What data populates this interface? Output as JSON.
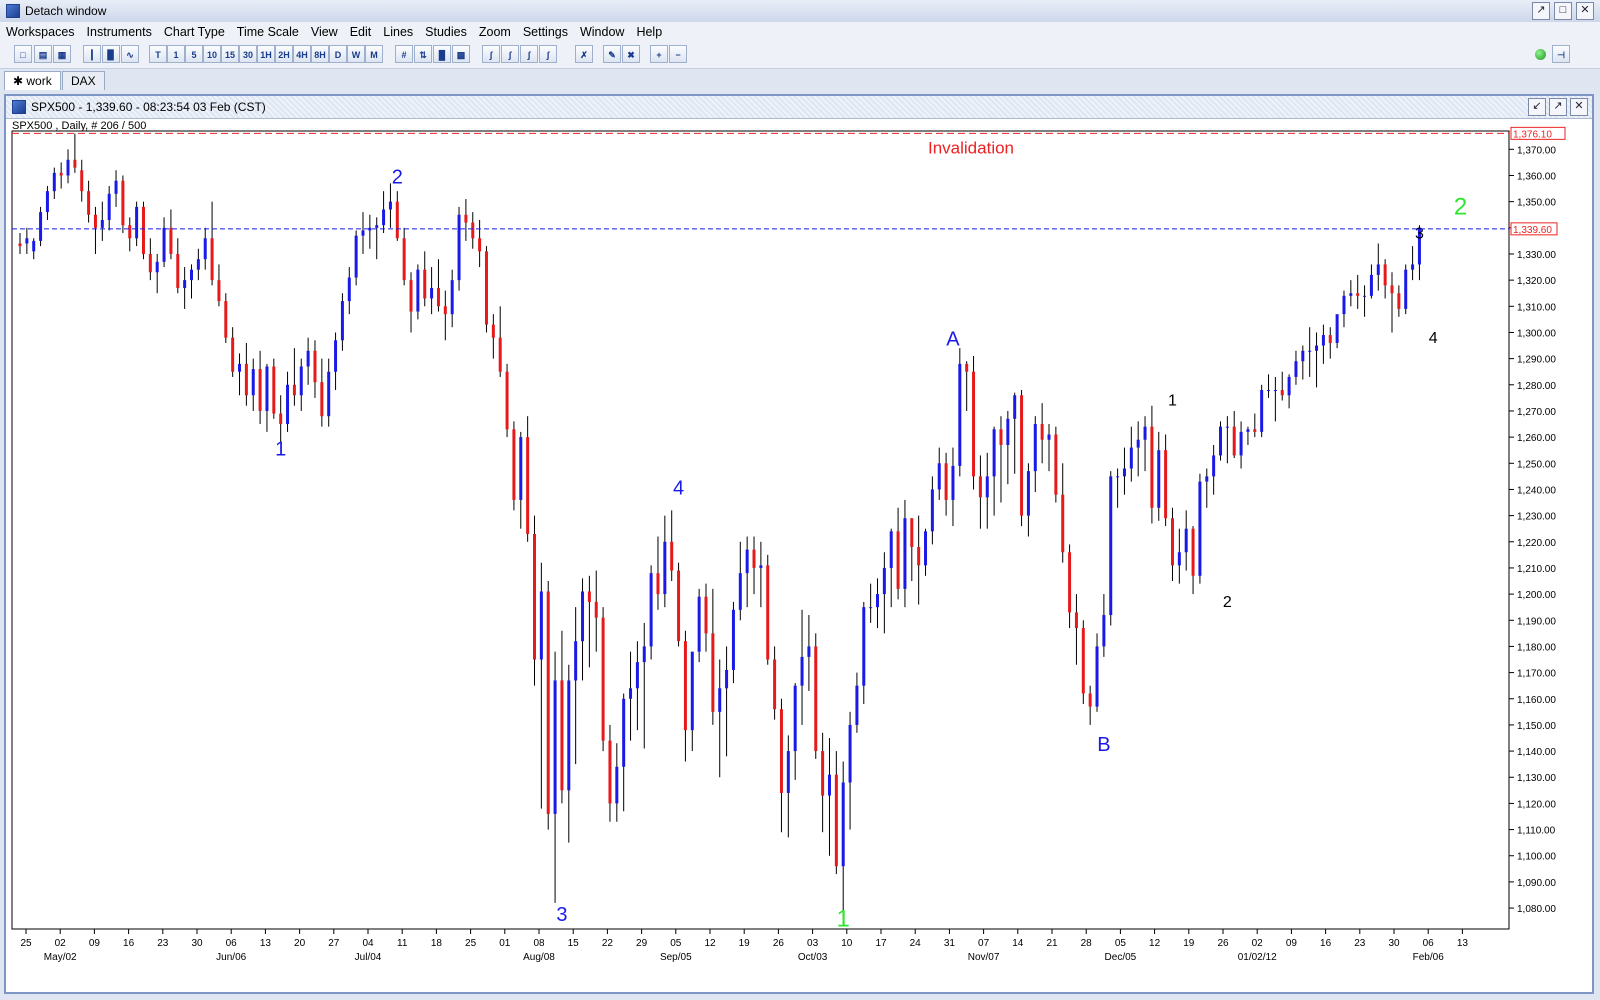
{
  "window": {
    "title": "Detach window"
  },
  "menu": [
    "Workspaces",
    "Instruments",
    "Chart Type",
    "Time Scale",
    "View",
    "Edit",
    "Lines",
    "Studies",
    "Zoom",
    "Settings",
    "Window",
    "Help"
  ],
  "toolbar": {
    "timeframes": [
      "T",
      "1",
      "5",
      "10",
      "15",
      "30",
      "1H",
      "2H",
      "4H",
      "8H",
      "D",
      "W",
      "M"
    ]
  },
  "tabs": [
    {
      "label": "✱ work",
      "active": true
    },
    {
      "label": "DAX",
      "active": false
    }
  ],
  "chart_window": {
    "title": "SPX500 - 1,339.60 - 08:23:54  03 Feb (CST)",
    "info": "SPX500 , Daily, # 206 / 500"
  },
  "chart_data": {
    "type": "candlestick",
    "instrument": "SPX500",
    "timeframe": "Daily",
    "last_price": 1339.6,
    "price_label": "1,339.60",
    "invalidation_level": 1376.1,
    "invalidation_label": "1,376.10",
    "invalidation_text": "Invalidation",
    "ylim": [
      1072,
      1377
    ],
    "y_ticks": [
      1080,
      1090,
      1100,
      1110,
      1120,
      1130,
      1140,
      1150,
      1160,
      1170,
      1180,
      1190,
      1200,
      1210,
      1220,
      1230,
      1240,
      1250,
      1260,
      1270,
      1280,
      1290,
      1300,
      1310,
      1320,
      1330,
      1340,
      1350,
      1360,
      1370
    ],
    "y_tick_labels": [
      "1,080.00",
      "1,090.00",
      "1,100.00",
      "1,110.00",
      "1,120.00",
      "1,130.00",
      "1,140.00",
      "1,150.00",
      "1,160.00",
      "1,170.00",
      "1,180.00",
      "1,190.00",
      "1,200.00",
      "1,210.00",
      "1,220.00",
      "1,230.00",
      "1,240.00",
      "1,250.00",
      "1,260.00",
      "1,270.00",
      "1,280.00",
      "1,290.00",
      "1,300.00",
      "1,310.00",
      "1,320.00",
      "1,330.00",
      "1,340.00",
      "1,350.00",
      "1,360.00",
      "1,370.00"
    ],
    "x_day_labels": [
      "25",
      "02",
      "09",
      "16",
      "23",
      "30",
      "06",
      "13",
      "20",
      "27",
      "04",
      "11",
      "18",
      "25",
      "01",
      "08",
      "15",
      "22",
      "29",
      "05",
      "12",
      "19",
      "26",
      "03",
      "10",
      "17",
      "24",
      "31",
      "07",
      "14",
      "21",
      "28",
      "05",
      "12",
      "19",
      "26",
      "02",
      "09",
      "16",
      "23",
      "30",
      "06",
      "13"
    ],
    "x_month_labels": [
      {
        "label": "May/02",
        "at": 1
      },
      {
        "label": "Jun/06",
        "at": 6
      },
      {
        "label": "Jul/04",
        "at": 10
      },
      {
        "label": "Aug/08",
        "at": 15
      },
      {
        "label": "Sep/05",
        "at": 19
      },
      {
        "label": "Oct/03",
        "at": 23
      },
      {
        "label": "Nov/07",
        "at": 28
      },
      {
        "label": "Dec/05",
        "at": 32
      },
      {
        "label": "01/02/12",
        "at": 36
      },
      {
        "label": "Feb/06",
        "at": 41
      }
    ],
    "wave_labels": [
      {
        "text": "1",
        "price": 1253,
        "idx": 38,
        "color": "#1a1ae6"
      },
      {
        "text": "2",
        "price": 1357,
        "idx": 55,
        "color": "#1a1ae6"
      },
      {
        "text": "3",
        "price": 1075,
        "idx": 79,
        "color": "#1a1ae6"
      },
      {
        "text": "4",
        "price": 1238,
        "idx": 96,
        "color": "#1a1ae6"
      },
      {
        "text": "1",
        "price": 1073,
        "idx": 120,
        "color": "#2ee62e"
      },
      {
        "text": "A",
        "price": 1295,
        "idx": 136,
        "color": "#1a1ae6"
      },
      {
        "text": "B",
        "price": 1140,
        "idx": 158,
        "color": "#1a1ae6"
      },
      {
        "text": "1",
        "price": 1272,
        "idx": 168,
        "color": "#000000"
      },
      {
        "text": "2",
        "price": 1195,
        "idx": 176,
        "color": "#000000"
      },
      {
        "text": "3",
        "price": 1336,
        "idx": 204,
        "color": "#000000"
      },
      {
        "text": "4",
        "price": 1296,
        "idx": 206,
        "color": "#000000"
      },
      {
        "text": "2",
        "price": 1345,
        "idx": 210,
        "color": "#2ee62e"
      }
    ],
    "candles": [
      [
        1334,
        1338,
        1330,
        1333
      ],
      [
        1334,
        1340,
        1330,
        1336
      ],
      [
        1331,
        1336,
        1328,
        1335
      ],
      [
        1335,
        1348,
        1333,
        1346
      ],
      [
        1346,
        1356,
        1343,
        1354
      ],
      [
        1354,
        1363,
        1351,
        1361
      ],
      [
        1361,
        1365,
        1355,
        1360
      ],
      [
        1360,
        1370,
        1357,
        1366
      ],
      [
        1366,
        1376,
        1361,
        1363
      ],
      [
        1362,
        1366,
        1350,
        1354
      ],
      [
        1354,
        1358,
        1342,
        1345
      ],
      [
        1345,
        1348,
        1330,
        1340
      ],
      [
        1340,
        1350,
        1335,
        1343
      ],
      [
        1343,
        1356,
        1339,
        1353
      ],
      [
        1353,
        1362,
        1348,
        1358
      ],
      [
        1358,
        1360,
        1338,
        1341
      ],
      [
        1341,
        1344,
        1331,
        1336
      ],
      [
        1336,
        1350,
        1333,
        1348
      ],
      [
        1348,
        1350,
        1328,
        1330
      ],
      [
        1330,
        1336,
        1320,
        1323
      ],
      [
        1323,
        1330,
        1315,
        1327
      ],
      [
        1327,
        1344,
        1325,
        1340
      ],
      [
        1340,
        1347,
        1328,
        1330
      ],
      [
        1330,
        1336,
        1315,
        1317
      ],
      [
        1317,
        1325,
        1309,
        1320
      ],
      [
        1320,
        1326,
        1313,
        1324
      ],
      [
        1324,
        1332,
        1320,
        1328
      ],
      [
        1328,
        1340,
        1324,
        1336
      ],
      [
        1336,
        1350,
        1318,
        1320
      ],
      [
        1320,
        1326,
        1310,
        1312
      ],
      [
        1312,
        1315,
        1296,
        1298
      ],
      [
        1298,
        1302,
        1283,
        1285
      ],
      [
        1285,
        1292,
        1276,
        1288
      ],
      [
        1288,
        1296,
        1272,
        1276
      ],
      [
        1276,
        1290,
        1270,
        1286
      ],
      [
        1286,
        1293,
        1265,
        1270
      ],
      [
        1270,
        1288,
        1262,
        1287
      ],
      [
        1287,
        1290,
        1267,
        1269
      ],
      [
        1269,
        1276,
        1258,
        1265
      ],
      [
        1265,
        1285,
        1262,
        1280
      ],
      [
        1280,
        1294,
        1272,
        1276
      ],
      [
        1276,
        1290,
        1270,
        1287
      ],
      [
        1287,
        1298,
        1280,
        1293
      ],
      [
        1293,
        1297,
        1275,
        1281
      ],
      [
        1281,
        1290,
        1264,
        1268
      ],
      [
        1268,
        1290,
        1264,
        1285
      ],
      [
        1285,
        1300,
        1278,
        1297
      ],
      [
        1297,
        1315,
        1293,
        1312
      ],
      [
        1312,
        1325,
        1307,
        1321
      ],
      [
        1321,
        1339,
        1318,
        1337
      ],
      [
        1337,
        1346,
        1330,
        1339
      ],
      [
        1339,
        1345,
        1332,
        1340
      ],
      [
        1340,
        1344,
        1328,
        1341
      ],
      [
        1341,
        1354,
        1338,
        1347
      ],
      [
        1347,
        1357,
        1340,
        1350
      ],
      [
        1350,
        1354,
        1335,
        1336
      ],
      [
        1336,
        1340,
        1318,
        1320
      ],
      [
        1320,
        1323,
        1300,
        1308
      ],
      [
        1308,
        1326,
        1305,
        1324
      ],
      [
        1324,
        1331,
        1310,
        1313
      ],
      [
        1313,
        1325,
        1307,
        1317
      ],
      [
        1317,
        1328,
        1308,
        1310
      ],
      [
        1310,
        1316,
        1297,
        1307
      ],
      [
        1307,
        1324,
        1302,
        1320
      ],
      [
        1320,
        1348,
        1316,
        1345
      ],
      [
        1345,
        1351,
        1335,
        1342
      ],
      [
        1342,
        1346,
        1332,
        1336
      ],
      [
        1336,
        1343,
        1325,
        1331
      ],
      [
        1331,
        1333,
        1300,
        1303
      ],
      [
        1303,
        1307,
        1290,
        1298
      ],
      [
        1298,
        1310,
        1283,
        1285
      ],
      [
        1285,
        1288,
        1260,
        1263
      ],
      [
        1263,
        1266,
        1232,
        1236
      ],
      [
        1236,
        1262,
        1225,
        1260
      ],
      [
        1260,
        1268,
        1220,
        1223
      ],
      [
        1223,
        1230,
        1165,
        1175
      ],
      [
        1175,
        1212,
        1118,
        1201
      ],
      [
        1201,
        1205,
        1110,
        1116
      ],
      [
        1116,
        1178,
        1082,
        1167
      ],
      [
        1167,
        1186,
        1120,
        1125
      ],
      [
        1125,
        1173,
        1105,
        1167
      ],
      [
        1167,
        1195,
        1135,
        1182
      ],
      [
        1182,
        1206,
        1167,
        1201
      ],
      [
        1201,
        1207,
        1172,
        1197
      ],
      [
        1197,
        1209,
        1178,
        1191
      ],
      [
        1191,
        1195,
        1140,
        1144
      ],
      [
        1144,
        1150,
        1113,
        1120
      ],
      [
        1120,
        1143,
        1113,
        1134
      ],
      [
        1134,
        1162,
        1117,
        1160
      ],
      [
        1160,
        1178,
        1144,
        1164
      ],
      [
        1164,
        1182,
        1148,
        1174
      ],
      [
        1174,
        1189,
        1141,
        1180
      ],
      [
        1180,
        1211,
        1175,
        1208
      ],
      [
        1208,
        1222,
        1194,
        1200
      ],
      [
        1200,
        1230,
        1195,
        1220
      ],
      [
        1220,
        1232,
        1205,
        1209
      ],
      [
        1209,
        1212,
        1180,
        1182
      ],
      [
        1182,
        1186,
        1136,
        1148
      ],
      [
        1148,
        1173,
        1140,
        1178
      ],
      [
        1178,
        1202,
        1174,
        1199
      ],
      [
        1199,
        1204,
        1178,
        1185
      ],
      [
        1185,
        1202,
        1150,
        1155
      ],
      [
        1155,
        1175,
        1130,
        1164
      ],
      [
        1164,
        1180,
        1138,
        1171
      ],
      [
        1171,
        1197,
        1166,
        1194
      ],
      [
        1194,
        1220,
        1190,
        1208
      ],
      [
        1208,
        1222,
        1195,
        1217
      ],
      [
        1217,
        1222,
        1200,
        1210
      ],
      [
        1210,
        1220,
        1195,
        1211
      ],
      [
        1211,
        1215,
        1173,
        1175
      ],
      [
        1175,
        1180,
        1152,
        1156
      ],
      [
        1156,
        1160,
        1109,
        1124
      ],
      [
        1124,
        1146,
        1107,
        1140
      ],
      [
        1140,
        1166,
        1129,
        1165
      ],
      [
        1165,
        1194,
        1150,
        1176
      ],
      [
        1176,
        1192,
        1163,
        1180
      ],
      [
        1180,
        1185,
        1137,
        1140
      ],
      [
        1140,
        1147,
        1109,
        1123
      ],
      [
        1123,
        1145,
        1100,
        1131
      ],
      [
        1131,
        1140,
        1093,
        1096
      ],
      [
        1096,
        1136,
        1076,
        1128
      ],
      [
        1128,
        1155,
        1110,
        1150
      ],
      [
        1150,
        1170,
        1147,
        1165
      ],
      [
        1165,
        1197,
        1158,
        1195
      ],
      [
        1195,
        1204,
        1189,
        1195
      ],
      [
        1195,
        1206,
        1187,
        1200
      ],
      [
        1200,
        1216,
        1185,
        1210
      ],
      [
        1210,
        1225,
        1195,
        1224
      ],
      [
        1224,
        1233,
        1198,
        1202
      ],
      [
        1202,
        1236,
        1195,
        1229
      ],
      [
        1229,
        1229,
        1205,
        1218
      ],
      [
        1218,
        1230,
        1196,
        1211
      ],
      [
        1211,
        1225,
        1207,
        1224
      ],
      [
        1224,
        1245,
        1219,
        1240
      ],
      [
        1240,
        1256,
        1236,
        1250
      ],
      [
        1250,
        1254,
        1230,
        1236
      ],
      [
        1236,
        1256,
        1226,
        1249
      ],
      [
        1249,
        1294,
        1245,
        1288
      ],
      [
        1288,
        1289,
        1270,
        1285
      ],
      [
        1285,
        1291,
        1240,
        1245
      ],
      [
        1245,
        1253,
        1225,
        1237
      ],
      [
        1237,
        1254,
        1225,
        1245
      ],
      [
        1245,
        1264,
        1230,
        1263
      ],
      [
        1263,
        1268,
        1235,
        1257
      ],
      [
        1257,
        1270,
        1242,
        1267
      ],
      [
        1267,
        1277,
        1246,
        1276
      ],
      [
        1276,
        1278,
        1226,
        1230
      ],
      [
        1230,
        1250,
        1222,
        1247
      ],
      [
        1247,
        1268,
        1239,
        1265
      ],
      [
        1265,
        1273,
        1250,
        1259
      ],
      [
        1259,
        1265,
        1247,
        1261
      ],
      [
        1261,
        1264,
        1235,
        1238
      ],
      [
        1238,
        1250,
        1212,
        1216
      ],
      [
        1216,
        1219,
        1187,
        1193
      ],
      [
        1193,
        1200,
        1173,
        1187
      ],
      [
        1187,
        1190,
        1158,
        1162
      ],
      [
        1162,
        1165,
        1150,
        1157
      ],
      [
        1157,
        1185,
        1155,
        1180
      ],
      [
        1180,
        1200,
        1176,
        1192
      ],
      [
        1192,
        1247,
        1188,
        1245
      ],
      [
        1245,
        1248,
        1233,
        1245
      ],
      [
        1245,
        1256,
        1238,
        1248
      ],
      [
        1248,
        1264,
        1243,
        1256
      ],
      [
        1256,
        1266,
        1245,
        1259
      ],
      [
        1259,
        1268,
        1247,
        1264
      ],
      [
        1264,
        1272,
        1227,
        1233
      ],
      [
        1233,
        1262,
        1228,
        1255
      ],
      [
        1255,
        1261,
        1226,
        1229
      ],
      [
        1229,
        1233,
        1205,
        1211
      ],
      [
        1211,
        1225,
        1204,
        1216
      ],
      [
        1216,
        1232,
        1209,
        1225
      ],
      [
        1225,
        1226,
        1200,
        1207
      ],
      [
        1207,
        1246,
        1204,
        1243
      ],
      [
        1243,
        1248,
        1233,
        1245
      ],
      [
        1245,
        1257,
        1238,
        1253
      ],
      [
        1253,
        1266,
        1251,
        1264
      ],
      [
        1264,
        1268,
        1250,
        1264
      ],
      [
        1264,
        1270,
        1252,
        1253
      ],
      [
        1253,
        1266,
        1248,
        1262
      ],
      [
        1262,
        1264,
        1257,
        1263
      ],
      [
        1263,
        1269,
        1260,
        1262
      ],
      [
        1262,
        1280,
        1260,
        1278
      ],
      [
        1278,
        1284,
        1275,
        1278
      ],
      [
        1278,
        1283,
        1266,
        1278
      ],
      [
        1278,
        1285,
        1274,
        1276
      ],
      [
        1276,
        1284,
        1271,
        1283
      ],
      [
        1283,
        1293,
        1280,
        1289
      ],
      [
        1289,
        1295,
        1282,
        1293
      ],
      [
        1293,
        1302,
        1283,
        1293
      ],
      [
        1293,
        1300,
        1279,
        1295
      ],
      [
        1295,
        1303,
        1288,
        1299
      ],
      [
        1299,
        1302,
        1290,
        1296
      ],
      [
        1296,
        1306,
        1294,
        1307
      ],
      [
        1307,
        1316,
        1302,
        1314
      ],
      [
        1314,
        1320,
        1310,
        1315
      ],
      [
        1315,
        1322,
        1309,
        1314
      ],
      [
        1314,
        1318,
        1306,
        1314
      ],
      [
        1314,
        1326,
        1313,
        1322
      ],
      [
        1322,
        1334,
        1316,
        1326
      ],
      [
        1326,
        1328,
        1313,
        1318
      ],
      [
        1318,
        1323,
        1300,
        1315
      ],
      [
        1315,
        1318,
        1306,
        1309
      ],
      [
        1309,
        1326,
        1307,
        1324
      ],
      [
        1324,
        1333,
        1320,
        1326
      ],
      [
        1326,
        1341,
        1320,
        1340
      ]
    ]
  }
}
